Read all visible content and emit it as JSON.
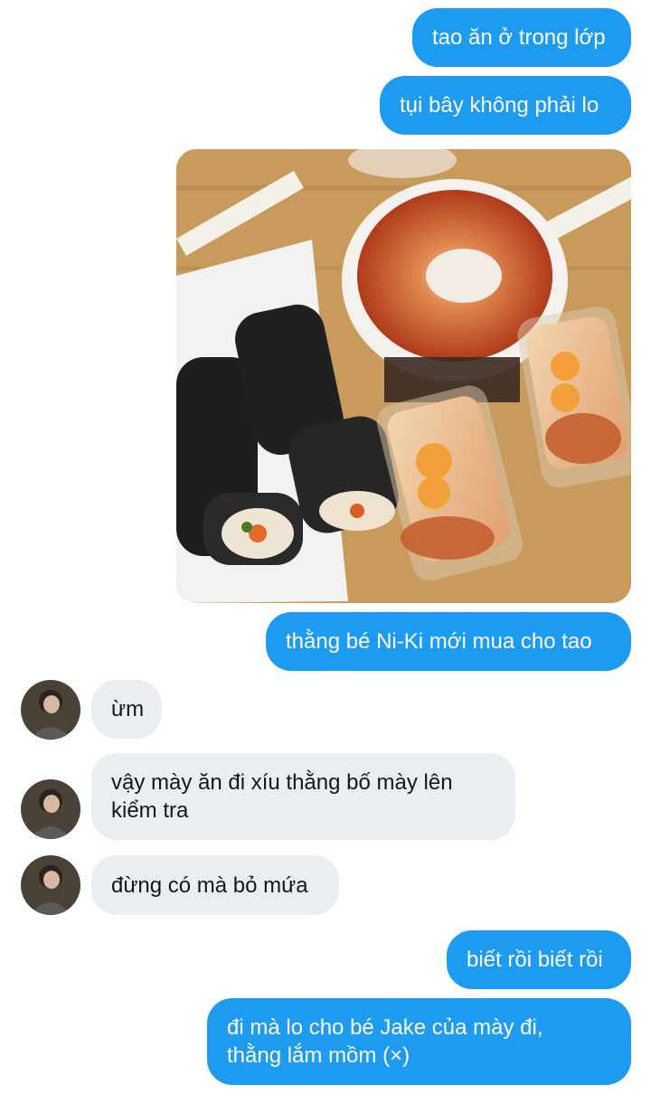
{
  "chat": {
    "messages": [
      {
        "text": "tao ăn ở trong lớp"
      },
      {
        "text": "tụi bây không phải lo"
      },
      {
        "text": "thằng bé Ni-Ki mới mua cho tao"
      },
      {
        "text": "ừm"
      },
      {
        "text": "vậy mày ăn đi xíu thằng bố mày lên\nkiểm tra"
      },
      {
        "text": "đừng có mà bỏ mứa"
      },
      {
        "text": "biết rồi biết rồi"
      },
      {
        "text": "đi mà lo cho bé Jake của mày đi,\nthằng lắm mồm (×)"
      }
    ]
  },
  "colors": {
    "sent_bubble": "#1d9bf0",
    "received_bubble": "#eaedf2",
    "background": "#ffffff"
  }
}
